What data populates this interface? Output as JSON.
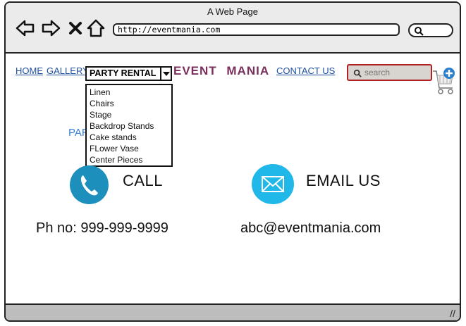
{
  "window": {
    "title": "A Web Page"
  },
  "browser": {
    "url": "http://eventmania.com"
  },
  "nav": {
    "home": "HOME",
    "gallery": "GALLERY",
    "party_rental": "PARTY RENTAL",
    "brand": "EVENT MANIA",
    "contact": "CONTACT US",
    "search_placeholder": "search"
  },
  "dropdown_items": [
    "Linen",
    "Chairs",
    "Stage",
    "Backdrop Stands",
    "Cake stands",
    "FLower Vase",
    "Center Pieces"
  ],
  "hidden_heading_fragment": "PAR",
  "contact": {
    "call_label": "CALL",
    "email_label": "EMAIL US",
    "phone": "Ph no: 999-999-9999",
    "email": "abc@eventmania.com"
  },
  "colors": {
    "call_circle": "#1c8fbd",
    "email_circle": "#20b8e8",
    "brand": "#7a2e5a",
    "link": "#1f4fa0"
  }
}
